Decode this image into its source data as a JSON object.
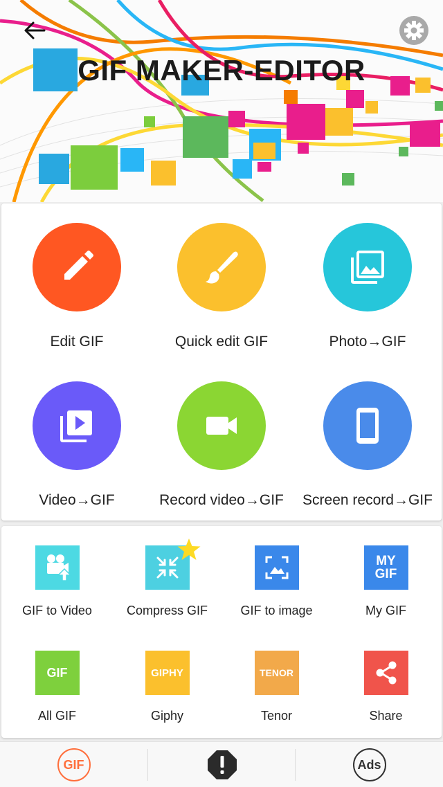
{
  "header": {
    "title": "GIF MAKER-EDITOR",
    "back_icon": "arrow-left-icon",
    "settings_icon": "gear-icon"
  },
  "tools": [
    {
      "label": "Edit GIF",
      "icon": "pencil-icon",
      "color": "#FF5722"
    },
    {
      "label": "Quick edit GIF",
      "icon": "brush-icon",
      "color": "#FBC02D"
    },
    {
      "label": "Photo→GIF",
      "icon": "photo-library-icon",
      "color": "#26C6DA"
    },
    {
      "label": "Video→GIF",
      "icon": "video-library-icon",
      "color": "#6A5AF9"
    },
    {
      "label": "Record video→GIF",
      "icon": "videocam-icon",
      "color": "#8BD633"
    },
    {
      "label": "Screen record→GIF",
      "icon": "phone-icon",
      "color": "#4A8BEA"
    }
  ],
  "extras": [
    {
      "label": "GIF to Video",
      "icon": "film-camera-icon",
      "color": "#4DD9E3"
    },
    {
      "label": "Compress GIF",
      "icon": "compress-icon",
      "color": "#4DD0E1",
      "badge": "star-icon"
    },
    {
      "label": "GIF to image",
      "icon": "image-frame-icon",
      "color": "#3A88EA"
    },
    {
      "label": "My GIF",
      "tile_text": "MY GIF",
      "color": "#3A88EA"
    },
    {
      "label": "All GIF",
      "tile_text": "GIF",
      "color": "#7ED03D"
    },
    {
      "label": "Giphy",
      "tile_text": "GIPHY",
      "color": "#FBC02D"
    },
    {
      "label": "Tenor",
      "tile_text": "TENOR",
      "color": "#F2A94A"
    },
    {
      "label": "Share",
      "icon": "share-icon",
      "color": "#F0544B"
    }
  ],
  "bottom_nav": {
    "gif_label": "GIF",
    "ads_label": "Ads",
    "alert_icon": "alert-octagon-icon",
    "gif_color": "#FF6F3C"
  }
}
